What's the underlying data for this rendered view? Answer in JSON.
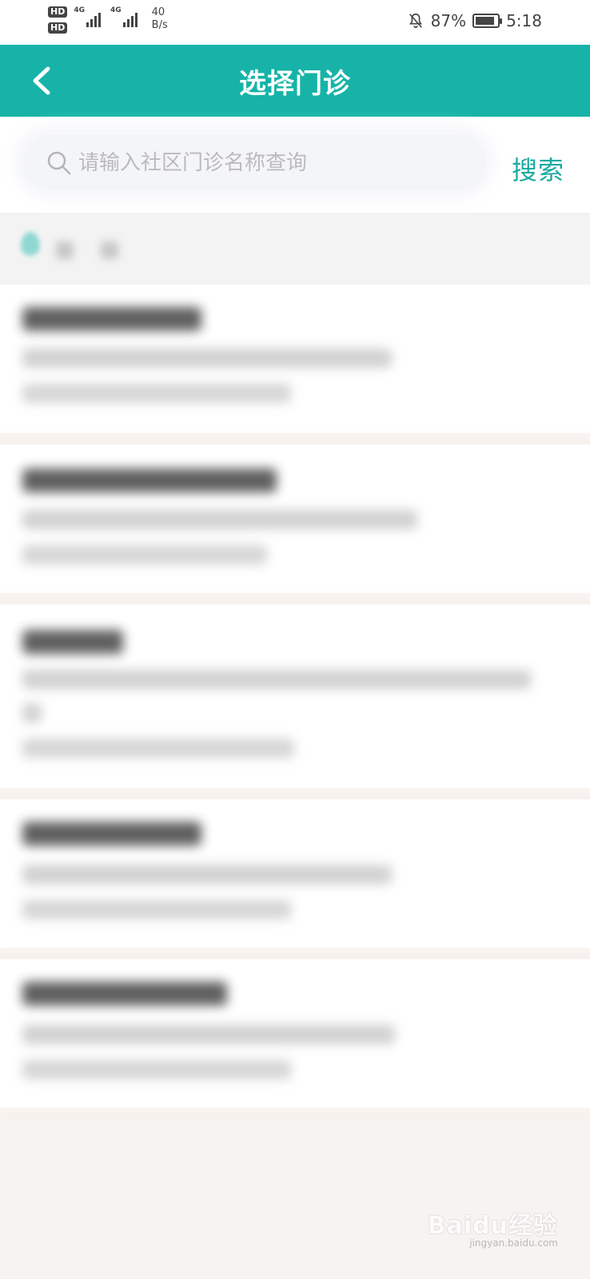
{
  "status_bar": {
    "hd1": "HD",
    "hd2": "HD",
    "net1": "4G",
    "net2": "4G",
    "speed_value": "40",
    "speed_unit": "B/s",
    "battery_percent": "87%",
    "battery_level": 0.87,
    "time": "5:18"
  },
  "header": {
    "title": "选择门诊",
    "accent_color": "#17b3a8"
  },
  "search": {
    "placeholder": "请输入社区门诊名称查询",
    "button_label": "搜索"
  },
  "watermark": {
    "text": "Baidu经验",
    "sub": "jingyan.baidu.com"
  }
}
